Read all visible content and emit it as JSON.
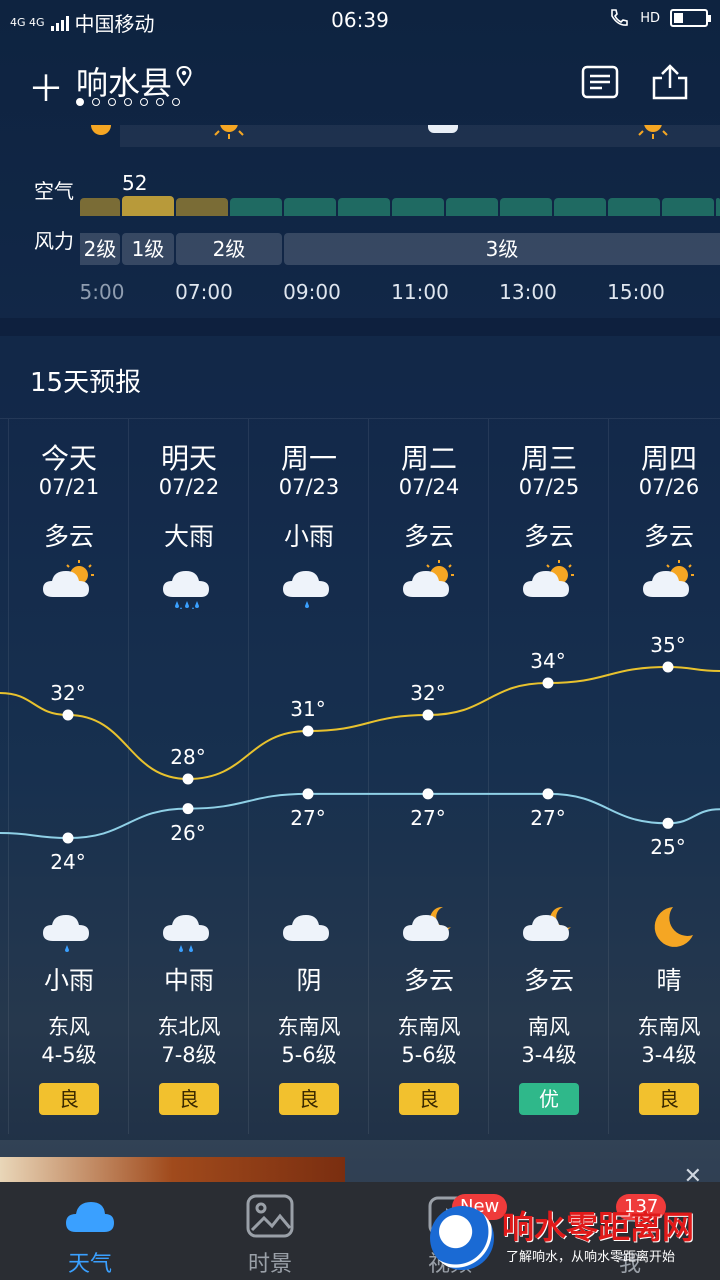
{
  "status": {
    "network": "4G 4G",
    "carrier": "中国移动",
    "time": "06:39",
    "hd": "HD",
    "battery_level": 0.3
  },
  "header": {
    "city": "响水县",
    "pages_total": 7,
    "pages_active": 1
  },
  "hourly": {
    "air_label": "空气",
    "wind_label": "风力",
    "air_value": "52",
    "wind_segments": [
      "2级",
      "1级",
      "2级",
      "3级"
    ],
    "times": [
      "5:00",
      "07:00",
      "09:00",
      "11:00",
      "13:00",
      "15:00"
    ]
  },
  "forecast": {
    "title": "15天预报",
    "days": [
      {
        "day": "今天",
        "date": "07/21",
        "day_cond": "多云",
        "day_icon": "partly-cloudy-icon",
        "high": "32°",
        "low": "24°",
        "night_cond": "小雨",
        "night_icon": "light-rain-icon",
        "wind_dir": "东风",
        "wind_level": "4-5级",
        "aqi": "良"
      },
      {
        "day": "明天",
        "date": "07/22",
        "day_cond": "大雨",
        "day_icon": "heavy-rain-icon",
        "high": "28°",
        "low": "26°",
        "night_cond": "中雨",
        "night_icon": "moderate-rain-icon",
        "wind_dir": "东北风",
        "wind_level": "7-8级",
        "aqi": "良"
      },
      {
        "day": "周一",
        "date": "07/23",
        "day_cond": "小雨",
        "day_icon": "light-rain-icon",
        "high": "31°",
        "low": "27°",
        "night_cond": "阴",
        "night_icon": "overcast-icon",
        "wind_dir": "东南风",
        "wind_level": "5-6级",
        "aqi": "良"
      },
      {
        "day": "周二",
        "date": "07/24",
        "day_cond": "多云",
        "day_icon": "partly-cloudy-icon",
        "high": "32°",
        "low": "27°",
        "night_cond": "多云",
        "night_icon": "partly-cloudy-night-icon",
        "wind_dir": "东南风",
        "wind_level": "5-6级",
        "aqi": "良"
      },
      {
        "day": "周三",
        "date": "07/25",
        "day_cond": "多云",
        "day_icon": "partly-cloudy-icon",
        "high": "34°",
        "low": "27°",
        "night_cond": "多云",
        "night_icon": "partly-cloudy-night-icon",
        "wind_dir": "南风",
        "wind_level": "3-4级",
        "aqi": "优"
      },
      {
        "day": "周四",
        "date": "07/26",
        "day_cond": "多云",
        "day_icon": "partly-cloudy-icon",
        "high": "35°",
        "low": "25°",
        "night_cond": "晴",
        "night_icon": "moon-icon",
        "wind_dir": "东南风",
        "wind_level": "3-4级",
        "aqi": "良"
      }
    ]
  },
  "tabs": [
    {
      "label": "天气",
      "icon": "cloud-icon",
      "active": true
    },
    {
      "label": "时景",
      "icon": "picture-icon"
    },
    {
      "label": "视频",
      "icon": "video-icon",
      "badge": "New"
    },
    {
      "label": "我",
      "icon": "user-icon",
      "badge": "137"
    }
  ],
  "watermark": {
    "title": "响水零距离网",
    "subtitle": "了解响水，从响水零距离开始"
  },
  "colors": {
    "accent": "#3aa0ff",
    "high_line": "#e8c22e",
    "low_line": "#8fd0e6",
    "aqi_good": "#f2c12e",
    "aqi_excellent": "#2fb88a"
  }
}
